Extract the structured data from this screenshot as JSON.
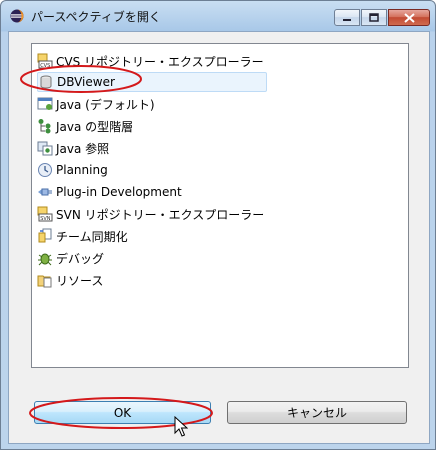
{
  "window": {
    "title": "パースペクティブを開く",
    "icon": "eclipse-icon",
    "controls": [
      "minimize",
      "maximize",
      "close"
    ]
  },
  "perspectives": [
    {
      "label": "CVS リポジトリー・エクスプローラー",
      "icon": "cvs-icon"
    },
    {
      "label": "DBViewer",
      "icon": "database-icon",
      "selected": true
    },
    {
      "label": "Java (デフォルト)",
      "icon": "java-perspective-icon"
    },
    {
      "label": "Java の型階層",
      "icon": "type-hierarchy-icon"
    },
    {
      "label": "Java 参照",
      "icon": "java-browsing-icon"
    },
    {
      "label": "Planning",
      "icon": "planning-icon"
    },
    {
      "label": "Plug-in Development",
      "icon": "plugin-icon"
    },
    {
      "label": "SVN リポジトリー・エクスプローラー",
      "icon": "svn-icon"
    },
    {
      "label": "チーム同期化",
      "icon": "team-sync-icon"
    },
    {
      "label": "デバッグ",
      "icon": "debug-icon"
    },
    {
      "label": "リソース",
      "icon": "resource-icon"
    }
  ],
  "buttons": {
    "ok": "OK",
    "cancel": "キャンセル"
  },
  "colors": {
    "annotation": "#d4191b",
    "selection_bg": "#eaf4fd",
    "default_button": "#bee6fd"
  }
}
